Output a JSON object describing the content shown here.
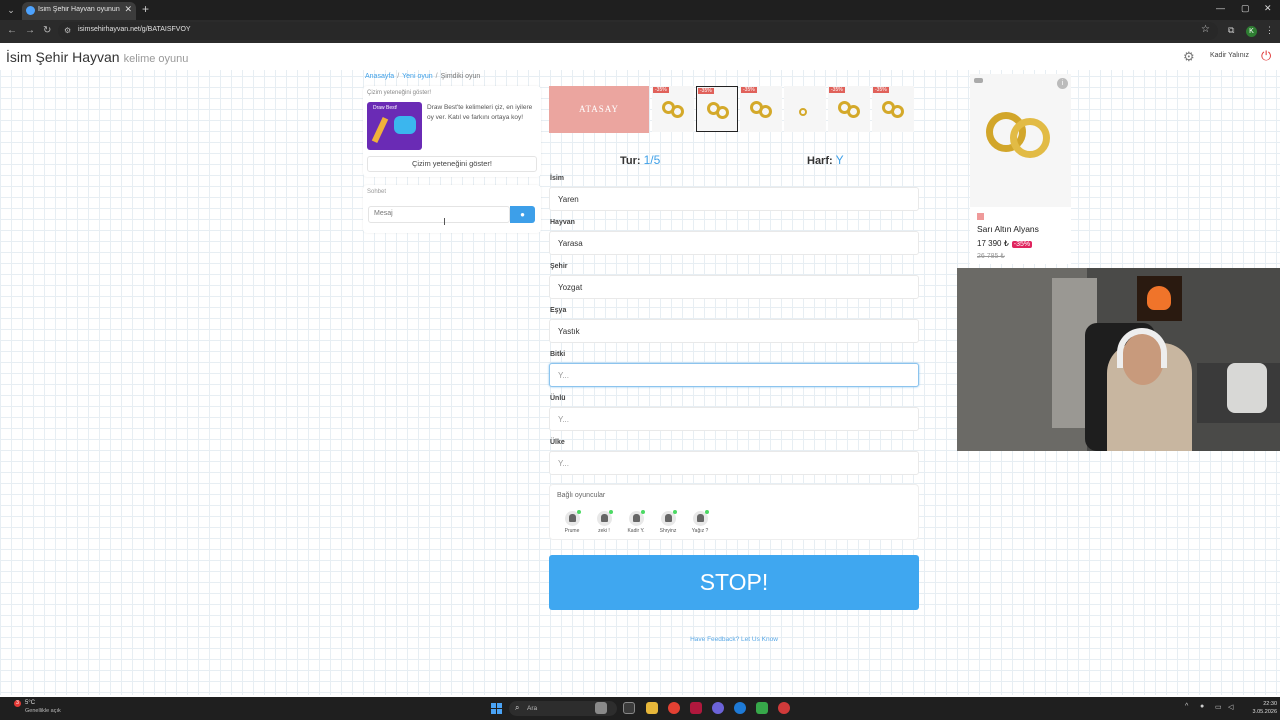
{
  "browser": {
    "tab_title": "İsim Şehir Hayvan oyununa kat",
    "tab_close": "✕",
    "new_tab": "+",
    "url": "isimsehirhayvan.net/g/BATAISFVOY",
    "profile_initial": "K"
  },
  "header": {
    "brand": "İsim Şehir Hayvan",
    "brand_sub": "kelime oyunu",
    "username": "Kadir Yalınız"
  },
  "breadcrumb": {
    "items": [
      "Anasayfa",
      "Yeni oyun",
      "Şimdiki oyun"
    ]
  },
  "promo": {
    "title": "Çizim yeteneğini göster!",
    "image_text": "Draw Best!",
    "text": "Draw Best'te kelimeleri çiz, en iyilere oy ver. Katıl ve farkını ortaya koy!",
    "button": "Çizim yeteneğini göster!"
  },
  "chat": {
    "title": "Sohbet",
    "placeholder": "Mesaj"
  },
  "ad_strip": {
    "logo": "ATASAY",
    "badge": "-35%"
  },
  "round": {
    "label": "Tur:",
    "value": "1/5",
    "letter_label": "Harf:",
    "letter_value": "Y"
  },
  "fields": [
    {
      "label": "İsim",
      "value": "Yaren"
    },
    {
      "label": "Hayvan",
      "value": "Yarasa"
    },
    {
      "label": "Şehir",
      "value": "Yozgat"
    },
    {
      "label": "Eşya",
      "value": "Yastık"
    },
    {
      "label": "Bitki",
      "value": "Y..."
    },
    {
      "label": "Ünlü",
      "value": "Y..."
    },
    {
      "label": "Ülke",
      "value": "Y..."
    }
  ],
  "players": {
    "title": "Bağlı oyuncular",
    "list": [
      "Prume",
      "zeki !",
      "Kadir Y.",
      "Shryinz",
      "Yağız ?"
    ]
  },
  "stop": "STOP!",
  "feedback": "Have Feedback? Let Us Know",
  "right_ad": {
    "product": "Sarı Altın Alyans",
    "price": "17 390 ₺",
    "discount": "-35%",
    "old_price": "26 785 ₺",
    "info": "i"
  },
  "taskbar": {
    "weather_temp": "5°C",
    "weather_desc": "Genellikle açık",
    "weather_badge": "3",
    "search_placeholder": "Ara",
    "time": "22:30",
    "date": "3.05.2026"
  }
}
